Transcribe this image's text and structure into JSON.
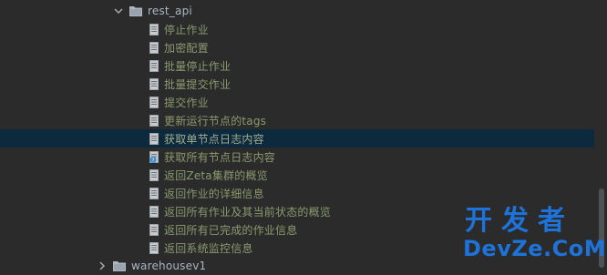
{
  "tree": {
    "folder_label": "rest_api",
    "items": [
      {
        "label": "停止作业"
      },
      {
        "label": "加密配置"
      },
      {
        "label": "批量停止作业"
      },
      {
        "label": "批量提交作业"
      },
      {
        "label": "提交作业"
      },
      {
        "label": "更新运行节点的tags"
      },
      {
        "label": "获取单节点日志内容",
        "selected": true
      },
      {
        "label": "获取所有节点日志内容",
        "icon": "doc-question-icon"
      },
      {
        "label": "返回Zeta集群的概览"
      },
      {
        "label": "返回作业的详细信息"
      },
      {
        "label": "返回所有作业及其当前状态的概览"
      },
      {
        "label": "返回所有已完成的作业信息"
      },
      {
        "label": "返回系统监控信息"
      }
    ],
    "next_folder_label": "warehousev1"
  },
  "watermark": {
    "line1": "开发者",
    "line2": "DevZe.CoM"
  },
  "colors": {
    "background": "#2b2b2b",
    "selected_row": "#0d293e",
    "item_text": "#8a9a6e",
    "folder_text": "#a9b7c6",
    "watermark": "#1e73d8"
  }
}
